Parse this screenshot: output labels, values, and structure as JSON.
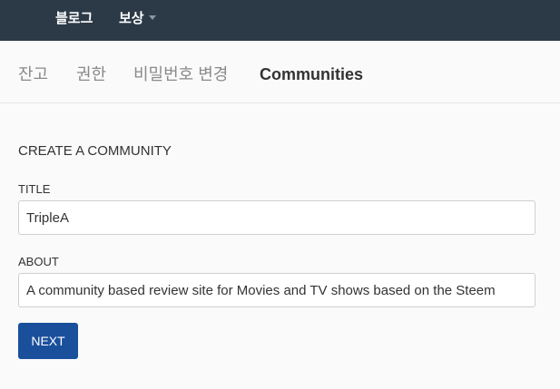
{
  "header": {
    "nav": [
      {
        "label": "블로그"
      },
      {
        "label": "보상"
      }
    ],
    "caret_icon": "chevron-down-icon",
    "background": "#2c3a48"
  },
  "tabs": [
    {
      "label": "잔고",
      "active": false
    },
    {
      "label": "권한",
      "active": false
    },
    {
      "label": "비밀번호 변경",
      "active": false
    },
    {
      "label": "Communities",
      "active": true
    }
  ],
  "form": {
    "section_title": "CREATE A COMMUNITY",
    "title_label": "TITLE",
    "title_value": "TripleA",
    "about_label": "ABOUT",
    "about_value": "A community based review site for Movies and TV shows based on the Steem",
    "next_label": "NEXT",
    "button_color": "#1a4f9c"
  }
}
